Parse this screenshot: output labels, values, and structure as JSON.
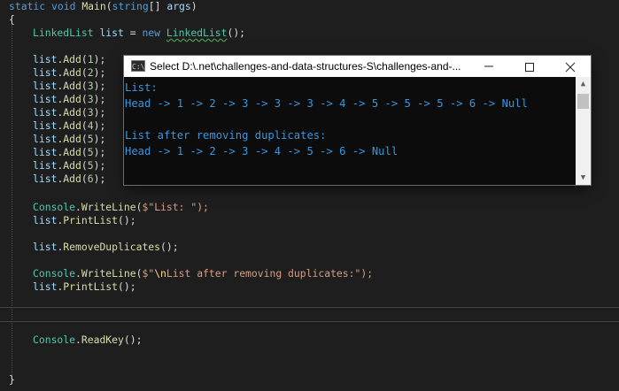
{
  "code": {
    "signature": {
      "static": "static",
      "void": "void",
      "method": "Main",
      "params_open": "(",
      "param_type": "string",
      "param_rest": "[] ",
      "param_name": "args",
      "params_close": ")"
    },
    "open_brace": "{",
    "close_brace": "}",
    "decl": {
      "type": "LinkedList",
      "var": "list",
      "op": " = ",
      "new": "new",
      "ctor": "LinkedList",
      "end": "();"
    },
    "adds": [
      {
        "obj": "list",
        "method": "Add",
        "arg": "1"
      },
      {
        "obj": "list",
        "method": "Add",
        "arg": "2"
      },
      {
        "obj": "list",
        "method": "Add",
        "arg": "3"
      },
      {
        "obj": "list",
        "method": "Add",
        "arg": "3"
      },
      {
        "obj": "list",
        "method": "Add",
        "arg": "3"
      },
      {
        "obj": "list",
        "method": "Add",
        "arg": "4"
      },
      {
        "obj": "list",
        "method": "Add",
        "arg": "5"
      },
      {
        "obj": "list",
        "method": "Add",
        "arg": "5"
      },
      {
        "obj": "list",
        "method": "Add",
        "arg": "5"
      },
      {
        "obj": "list",
        "method": "Add",
        "arg": "6"
      }
    ],
    "writeline1": {
      "cls": "Console",
      "method": "WriteLine",
      "open": "(",
      "prefix": "$\"",
      "text": "List: ",
      "close": "\");"
    },
    "print1": {
      "obj": "list",
      "method": "PrintList",
      "end": "();"
    },
    "remove": {
      "obj": "list",
      "method": "RemoveDuplicates",
      "end": "();"
    },
    "writeline2": {
      "cls": "Console",
      "method": "WriteLine",
      "open": "(",
      "prefix": "$\"",
      "escape": "\\n",
      "text": "List after removing duplicates:",
      "close": "\");"
    },
    "print2": {
      "obj": "list",
      "method": "PrintList",
      "end": "();"
    },
    "readkey": {
      "cls": "Console",
      "method": "ReadKey",
      "end": "();"
    }
  },
  "console": {
    "icon_label": "C:\\",
    "title": "Select D:\\.net\\challenges-and-data-structures-S\\challenges-and-...",
    "lines": [
      "List:",
      "Head -> 1 -> 2 -> 3 -> 3 -> 3 -> 4 -> 5 -> 5 -> 5 -> 6 -> Null",
      "",
      "List after removing duplicates:",
      "Head -> 1 -> 2 -> 3 -> 4 -> 5 -> 6 -> Null"
    ],
    "scroll_up": "▲",
    "scroll_down": "▼"
  },
  "colors": {
    "editor_bg": "#1e1e1e",
    "keyword": "#569cd6",
    "type": "#4ec9b0",
    "method": "#dcdcaa",
    "variable": "#9cdcfe",
    "string": "#d69d85",
    "console_text": "#3a96dd"
  }
}
